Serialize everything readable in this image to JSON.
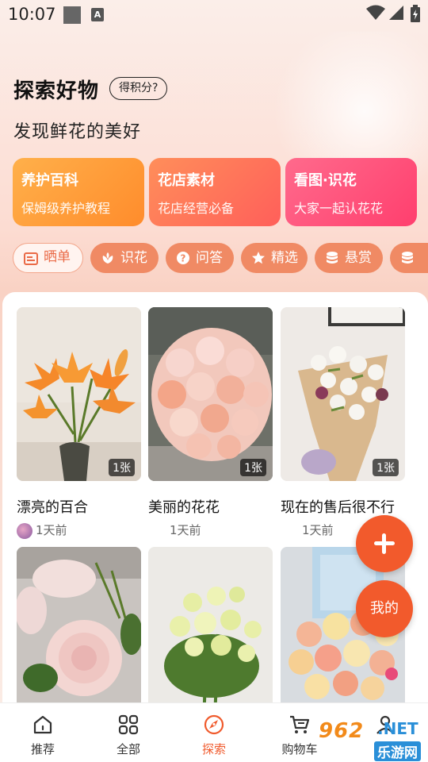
{
  "status_bar": {
    "time": "10:07",
    "notif_badge": "A"
  },
  "header": {
    "title": "探索好物",
    "points_button": "得积分?",
    "subtitle": "发现鲜花的美好"
  },
  "cards": [
    {
      "title": "养护百科",
      "subtitle": "保姆级养护教程",
      "color": "#ff9a3a"
    },
    {
      "title": "花店素材",
      "subtitle": "花店经营必备",
      "color": "#ff6f5a"
    },
    {
      "title": "看图·识花",
      "subtitle": "大家一起认花花",
      "color": "#ff4f7c"
    }
  ],
  "chips": [
    {
      "label": "晒单",
      "icon": "photo-icon",
      "active": true
    },
    {
      "label": "识花",
      "icon": "flower-icon"
    },
    {
      "label": "问答",
      "icon": "question-icon"
    },
    {
      "label": "精选",
      "icon": "star-icon"
    },
    {
      "label": "悬赏",
      "icon": "coins-icon"
    },
    {
      "label": "",
      "icon": "coins-icon"
    }
  ],
  "feed": [
    {
      "title": "漂亮的百合",
      "time": "1天前",
      "count": "1张",
      "has_avatar": true
    },
    {
      "title": "美丽的花花",
      "time": "1天前",
      "count": "1张",
      "has_avatar": false
    },
    {
      "title": "现在的售后很不行",
      "time": "1天前",
      "count": "1张",
      "has_avatar": false
    },
    {
      "title": "",
      "time": "",
      "count": "",
      "has_avatar": false
    },
    {
      "title": "",
      "time": "",
      "count": "",
      "has_avatar": false
    },
    {
      "title": "",
      "time": "",
      "count": "",
      "has_avatar": false
    }
  ],
  "fab": {
    "mine_label": "我的"
  },
  "bottom_nav": [
    {
      "label": "推荐",
      "icon": "home-icon"
    },
    {
      "label": "全部",
      "icon": "grid-icon"
    },
    {
      "label": "探索",
      "icon": "explore-icon",
      "active": true
    },
    {
      "label": "购物车",
      "icon": "cart-icon"
    },
    {
      "label": "",
      "icon": "person-icon"
    }
  ],
  "watermark": {
    "brand": "962",
    "tld": ".NET",
    "site": "乐游网"
  },
  "colors": {
    "accent": "#f25a2c",
    "chip": "#f08a64",
    "active_text": "#ea6a47"
  }
}
